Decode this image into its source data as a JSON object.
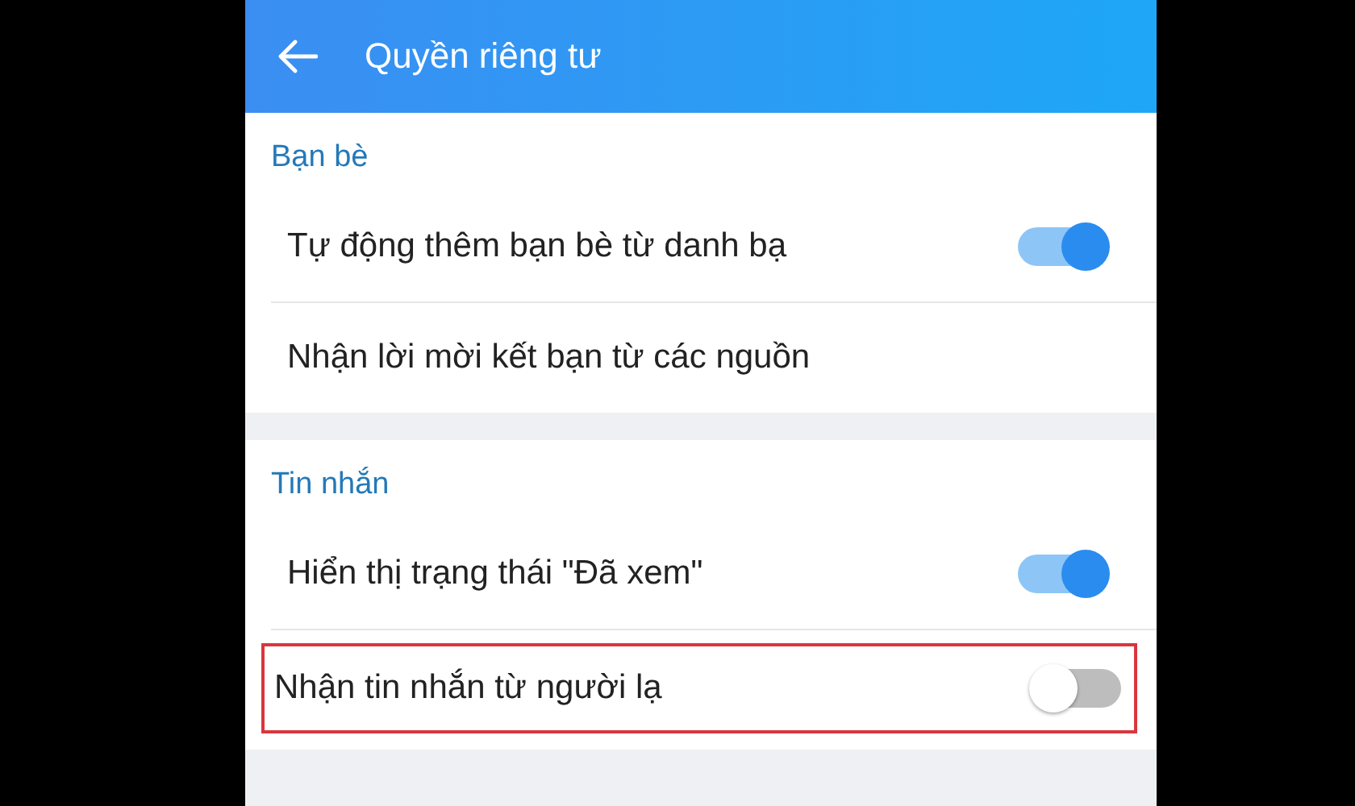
{
  "header": {
    "title": "Quyền riêng tư"
  },
  "sections": [
    {
      "title": "Bạn bè",
      "items": [
        {
          "kind": "toggle",
          "label": "Tự động thêm bạn bè từ danh bạ",
          "on": true,
          "highlighted": false
        },
        {
          "kind": "plain",
          "label": "Nhận lời mời kết bạn từ các nguồn",
          "highlighted": false
        }
      ]
    },
    {
      "title": "Tin nhắn",
      "items": [
        {
          "kind": "toggle",
          "label": "Hiển thị trạng thái \"Đã xem\"",
          "on": true,
          "highlighted": false
        },
        {
          "kind": "toggle",
          "label": "Nhận tin nhắn từ người lạ",
          "on": false,
          "highlighted": true
        }
      ]
    }
  ]
}
